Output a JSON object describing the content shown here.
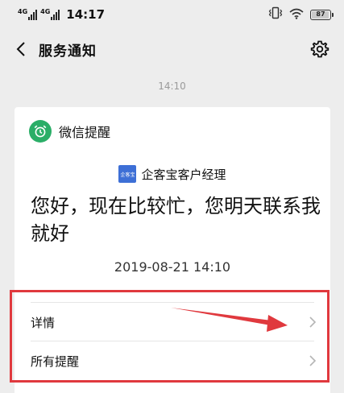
{
  "status_bar": {
    "signal_1_label": "4G",
    "signal_2_label": "4G",
    "time": "14:17",
    "battery_level": "87"
  },
  "nav": {
    "title": "服务通知"
  },
  "conversation": {
    "timestamp": "14:10"
  },
  "card": {
    "app_name": "微信提醒",
    "sender_logo_text": "企客宝",
    "sender_name": "企客宝客户经理",
    "message": "您好，现在比较忙，您明天联系我就好",
    "message_time": "2019-08-21 14:10",
    "actions": [
      {
        "label": "详情"
      },
      {
        "label": "所有提醒"
      }
    ]
  },
  "colors": {
    "accent_green": "#2aae67",
    "sender_blue": "#3d6fd6",
    "annotation_red": "#e0393e",
    "background": "#ededed"
  },
  "icons": {
    "back": "chevron-left-icon",
    "settings": "gear-icon",
    "app": "alarm-clock-icon",
    "row": "chevron-right-icon",
    "vibrate": "vibrate-icon",
    "wifi": "wifi-icon"
  }
}
